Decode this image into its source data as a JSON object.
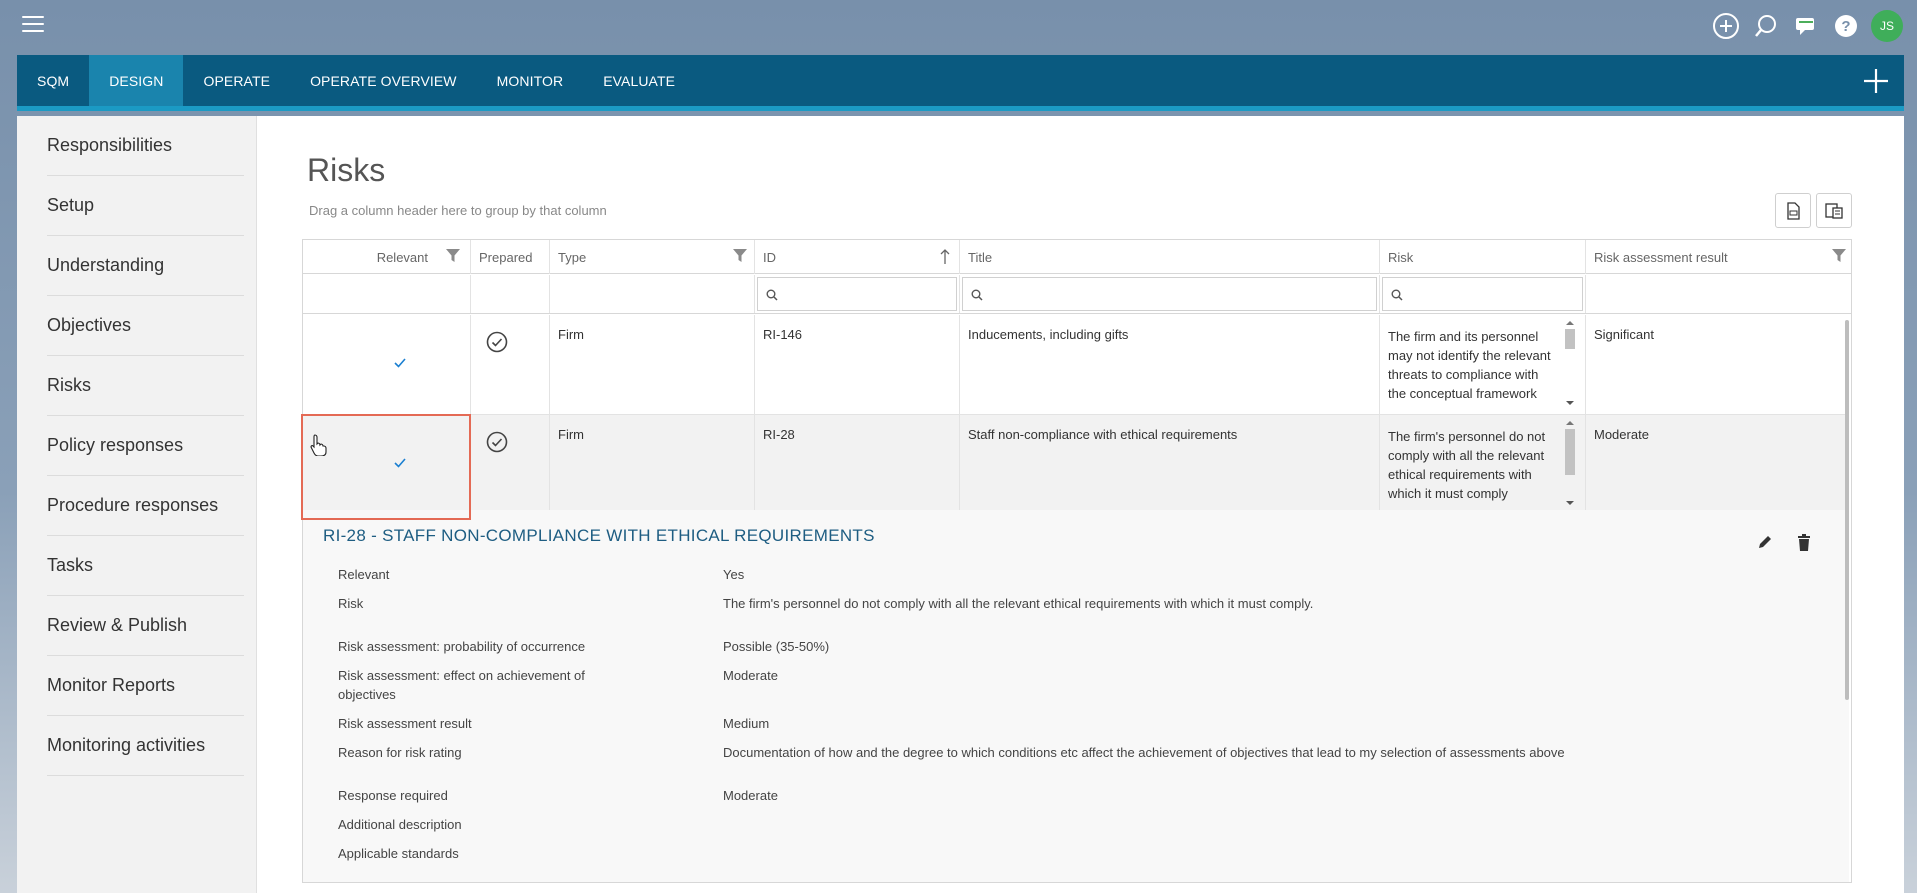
{
  "topbar": {
    "icons": [
      "add-circle-icon",
      "search-icon",
      "chat-icon",
      "help-icon"
    ],
    "avatar_initials": "JS"
  },
  "nav": {
    "tabs": [
      {
        "label": "SQM",
        "active": false
      },
      {
        "label": "DESIGN",
        "active": true
      },
      {
        "label": "OPERATE",
        "active": false
      },
      {
        "label": "OPERATE OVERVIEW",
        "active": false
      },
      {
        "label": "MONITOR",
        "active": false
      },
      {
        "label": "EVALUATE",
        "active": false
      }
    ]
  },
  "sidebar": {
    "items": [
      {
        "label": "Responsibilities"
      },
      {
        "label": "Setup"
      },
      {
        "label": "Understanding"
      },
      {
        "label": "Objectives"
      },
      {
        "label": "Risks"
      },
      {
        "label": "Policy responses"
      },
      {
        "label": "Procedure responses"
      },
      {
        "label": "Tasks"
      },
      {
        "label": "Review & Publish"
      },
      {
        "label": "Monitor Reports"
      },
      {
        "label": "Monitoring activities"
      }
    ]
  },
  "page": {
    "title": "Risks",
    "group_hint": "Drag a column header here to group by that column"
  },
  "grid": {
    "columns": [
      "Relevant",
      "Prepared",
      "Type",
      "ID",
      "Title",
      "Risk",
      "Risk assessment result"
    ],
    "rows": [
      {
        "relevant": true,
        "prepared": true,
        "type": "Firm",
        "id": "RI-146",
        "title": "Inducements, including gifts",
        "risk": "The firm and its personnel may not identify the relevant threats to compliance with the conceptual framework",
        "result": "Significant"
      },
      {
        "relevant": true,
        "prepared": true,
        "type": "Firm",
        "id": "RI-28",
        "title": "Staff non-compliance with ethical requirements",
        "risk": "The firm's personnel do not comply with all the relevant ethical requirements with which it must comply",
        "result": "Moderate"
      }
    ]
  },
  "detail": {
    "title": "RI-28 - STAFF NON-COMPLIANCE WITH ETHICAL REQUIREMENTS",
    "fields": [
      {
        "label": "Relevant",
        "value": "Yes"
      },
      {
        "label": "Risk",
        "value": "The firm's personnel do not comply with all the relevant ethical requirements with which it must comply."
      },
      {
        "label": "Risk assessment: probability of occurrence",
        "value": "Possible (35-50%)"
      },
      {
        "label": "Risk assessment: effect on achievement of objectives",
        "value": "Moderate"
      },
      {
        "label": "Risk assessment result",
        "value": "Medium"
      },
      {
        "label": "Reason for risk rating",
        "value": "Documentation of how and the degree to which conditions etc affect the achievement of objectives that lead to my selection of assessments above"
      },
      {
        "label": "Response required",
        "value": "Moderate"
      },
      {
        "label": "Additional description",
        "value": ""
      },
      {
        "label": "Applicable standards",
        "value": ""
      }
    ]
  },
  "colors": {
    "nav_bg": "#0a5a80",
    "nav_active": "#1a84ad",
    "nav_underline": "#1b9ac4",
    "highlight_border": "#e46a55",
    "avatar_bg": "#3fae5a",
    "detail_title": "#1e5d82"
  }
}
